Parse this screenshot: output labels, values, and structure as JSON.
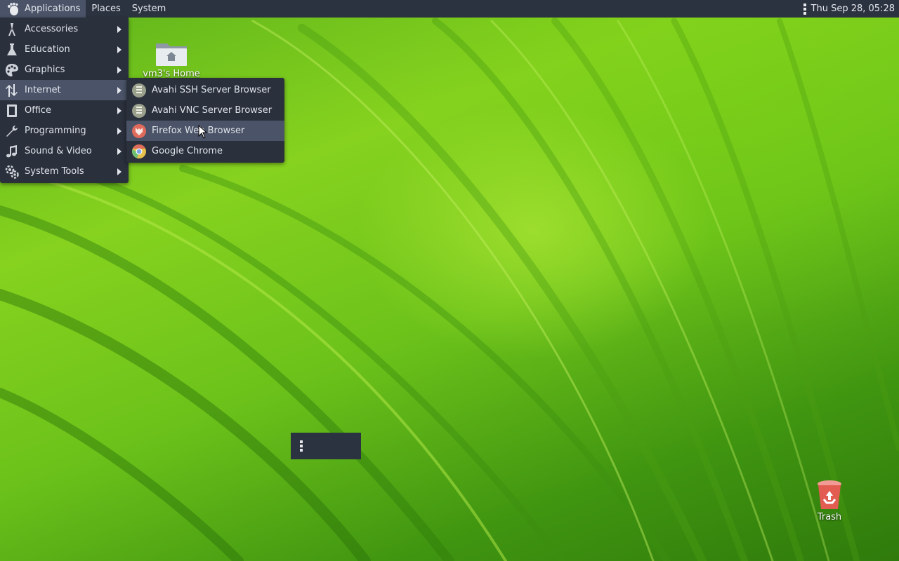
{
  "top_panel": {
    "menus": [
      "Applications",
      "Places",
      "System"
    ],
    "clock": "Thu Sep 28, 05:28",
    "logo_icon": "gnome-foot-icon"
  },
  "applications_menu": {
    "items": [
      {
        "label": "Accessories",
        "icon": "accessories-icon"
      },
      {
        "label": "Education",
        "icon": "flask-icon"
      },
      {
        "label": "Graphics",
        "icon": "palette-icon"
      },
      {
        "label": "Internet",
        "icon": "network-arrows-icon",
        "highlighted": true
      },
      {
        "label": "Office",
        "icon": "document-icon"
      },
      {
        "label": "Programming",
        "icon": "wrench-icon"
      },
      {
        "label": "Sound & Video",
        "icon": "music-note-icon"
      },
      {
        "label": "System Tools",
        "icon": "gears-icon"
      }
    ]
  },
  "internet_submenu": {
    "items": [
      {
        "label": "Avahi SSH Server Browser",
        "icon": "avahi-server-icon"
      },
      {
        "label": "Avahi VNC Server Browser",
        "icon": "avahi-server-icon"
      },
      {
        "label": "Firefox Web Browser",
        "icon": "firefox-icon",
        "highlighted": true
      },
      {
        "label": "Google Chrome",
        "icon": "chrome-icon"
      }
    ]
  },
  "desktop_icons": {
    "home": {
      "label": "vm3's Home",
      "icon": "home-folder-icon"
    },
    "trash": {
      "label": "Trash",
      "icon": "trash-icon"
    }
  },
  "colors": {
    "panel_bg": "#2c3340",
    "menu_bg": "#2a303c",
    "highlight_bg": "#4a5367",
    "wallpaper_green": "#6cc21a"
  }
}
